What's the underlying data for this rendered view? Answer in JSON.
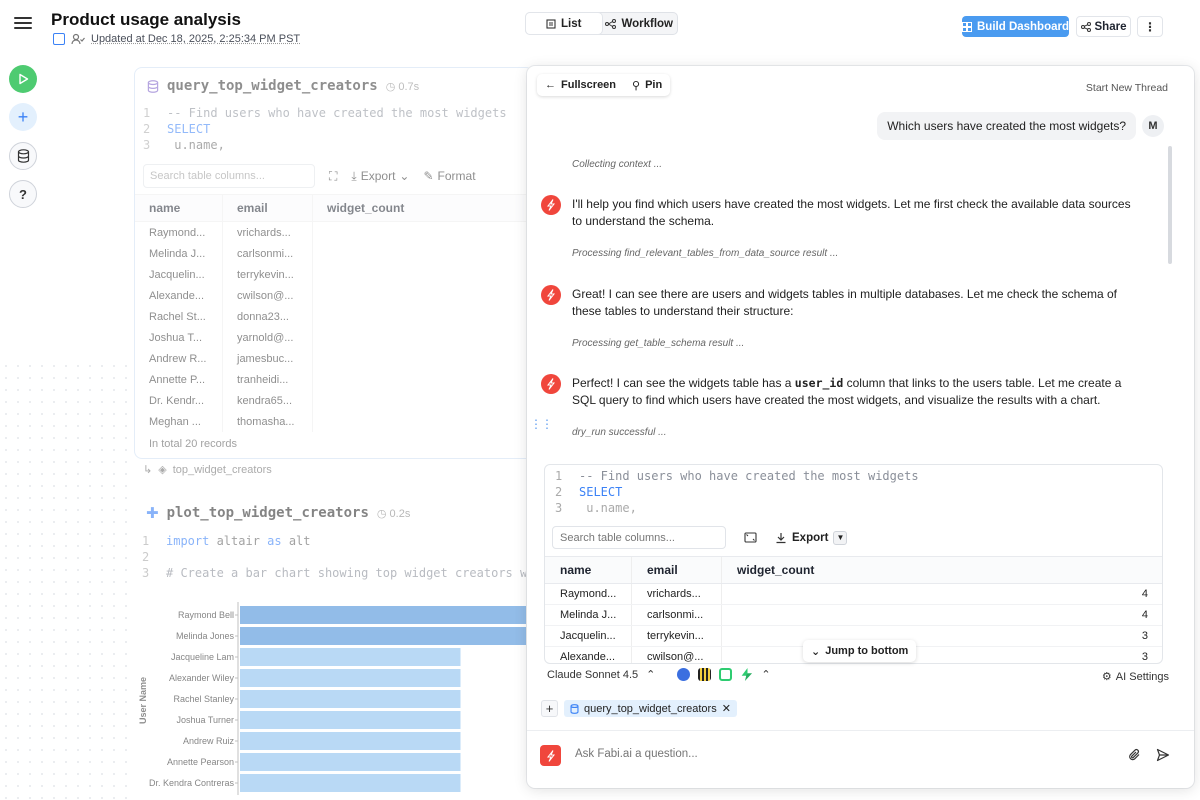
{
  "header": {
    "title": "Product usage analysis",
    "updated": "Updated at Dec 18, 2025, 2:25:34 PM PST",
    "view_list": "List",
    "view_workflow": "Workflow",
    "build_dashboard": "Build Dashboard",
    "share": "Share",
    "more": "⋮"
  },
  "rail": {
    "add": "+",
    "help": "?"
  },
  "cell1": {
    "title": "query_top_widget_creators",
    "duration": "0.7s",
    "code": [
      {
        "ln": "1",
        "text": "-- Find users who have created the most widgets"
      },
      {
        "ln": "2",
        "text": "SELECT"
      },
      {
        "ln": "3",
        "text": "    u.name,"
      }
    ],
    "search_placeholder": "Search table columns...",
    "export": "Export",
    "format": "Format",
    "columns": [
      "name",
      "email",
      "widget_count"
    ],
    "rows": [
      [
        "Raymond...",
        "vrichards..."
      ],
      [
        "Melinda J...",
        "carlsonmi..."
      ],
      [
        "Jacquelin...",
        "terrykevin..."
      ],
      [
        "Alexande...",
        "cwilson@..."
      ],
      [
        "Rachel St...",
        "donna23..."
      ],
      [
        "Joshua T...",
        "yarnold@..."
      ],
      [
        "Andrew R...",
        "jamesbuc..."
      ],
      [
        "Annette P...",
        "tranheidi..."
      ],
      [
        "Dr. Kendr...",
        "kendra65..."
      ],
      [
        "Meghan ...",
        "thomasha..."
      ]
    ],
    "total": "In total 20 records",
    "link": "top_widget_creators"
  },
  "cell2": {
    "title": "plot_top_widget_creators",
    "duration": "0.2s",
    "code": [
      {
        "ln": "1",
        "kw": "import",
        "text": " altair ",
        "kw2": "as",
        "text2": " alt"
      },
      {
        "ln": "2",
        "kw": "",
        "text": "",
        "kw2": "",
        "text2": ""
      },
      {
        "ln": "3",
        "kw": "",
        "text": "# Create a bar chart showing top widget creators with",
        "kw2": "",
        "text2": ""
      }
    ]
  },
  "chart_data": {
    "type": "bar",
    "orientation": "horizontal",
    "ylabel": "User Name",
    "categories": [
      "Raymond Bell",
      "Melinda Jones",
      "Jacqueline Lam",
      "Alexander Wiley",
      "Rachel Stanley",
      "Joshua Turner",
      "Andrew Ruiz",
      "Annette Pearson",
      "Dr. Kendra Contreras"
    ],
    "values": [
      4,
      4,
      3,
      3,
      3,
      3,
      3,
      3,
      3
    ],
    "colors": [
      "#4a90d9",
      "#4a90d9",
      "#8cc1ef",
      "#8cc1ef",
      "#8cc1ef",
      "#8cc1ef",
      "#8cc1ef",
      "#8cc1ef",
      "#8cc1ef"
    ]
  },
  "chat": {
    "fullscreen": "Fullscreen",
    "pin": "Pin",
    "new_thread": "Start New Thread",
    "user_message": "Which users have created the most widgets?",
    "user_initial": "M",
    "status1": "Collecting context ...",
    "msg1": "I'll help you find which users have created the most widgets. Let me first check the available data sources to understand the schema.",
    "status2": "Processing find_relevant_tables_from_data_source result ...",
    "msg2": "Great! I can see there are users and widgets tables in multiple databases. Let me check the schema of these tables to understand their structure:",
    "status3": "Processing get_table_schema result ...",
    "msg3_a": "Perfect! I can see the widgets table has a ",
    "msg3_code": "user_id",
    "msg3_b": " column that links to the users table. Let me create a SQL query to find which users have created the most widgets, and visualize the results with a chart.",
    "status4": "dry_run successful ...",
    "result": {
      "code": [
        {
          "ln": "1",
          "text": "-- Find users who have created the most widgets"
        },
        {
          "ln": "2",
          "text": "SELECT"
        },
        {
          "ln": "3",
          "text": "    u.name,"
        }
      ],
      "search_placeholder": "Search table columns...",
      "export": "Export",
      "columns": [
        "name",
        "email",
        "widget_count"
      ],
      "rows": [
        [
          "Raymond...",
          "vrichards...",
          "4"
        ],
        [
          "Melinda J...",
          "carlsonmi...",
          "4"
        ],
        [
          "Jacquelin...",
          "terrykevin...",
          "3"
        ],
        [
          "Alexande...",
          "cwilson@...",
          "3"
        ]
      ]
    },
    "jump": "Jump to bottom",
    "model": "Claude Sonnet 4.5",
    "ai_settings": "AI Settings",
    "context_chip": "query_top_widget_creators",
    "input_placeholder": "Ask Fabi.ai a question..."
  },
  "colors": {
    "accent": "#4a9bf0",
    "run_green": "#4ecb71",
    "brand_red": "#f0463c"
  }
}
